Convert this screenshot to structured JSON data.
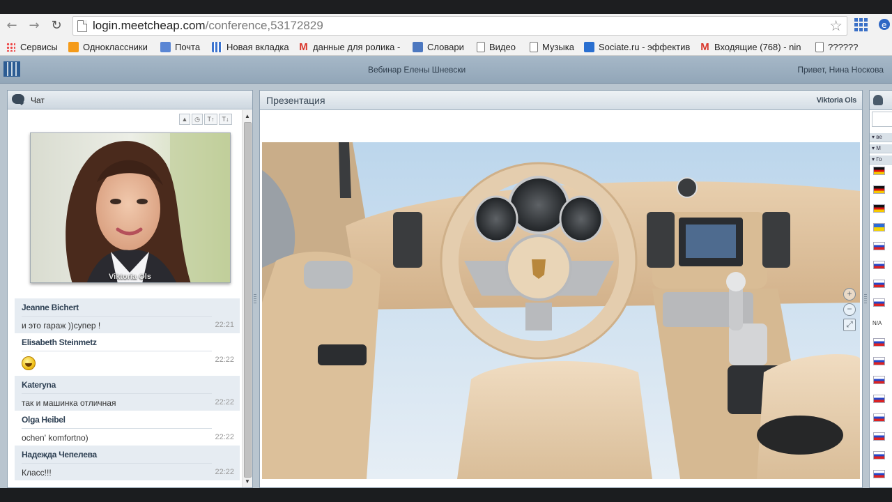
{
  "browser": {
    "url_host": "login.meetcheap.com",
    "url_path": "/conference,53172829",
    "back_icon": "back-arrow-icon",
    "forward_icon": "forward-arrow-icon",
    "reload_icon": "reload-icon",
    "bookmark_star_icon": "star-icon",
    "apps_icon": "apps-grid-icon"
  },
  "bookmarks": [
    {
      "label": "Сервисы",
      "icon": "apps-grid-icon"
    },
    {
      "label": "Одноклассники",
      "icon": "odnoklassniki-icon"
    },
    {
      "label": "Почта",
      "icon": "mail-icon"
    },
    {
      "label": "Новая вкладка",
      "icon": "tabs-icon"
    },
    {
      "label": "данные для ролика -",
      "icon": "gmail-icon"
    },
    {
      "label": "Словари",
      "icon": "dictionary-icon"
    },
    {
      "label": "Видео",
      "icon": "page-icon"
    },
    {
      "label": "Музыка",
      "icon": "page-icon"
    },
    {
      "label": "Sociate.ru - эффектив",
      "icon": "sociate-icon"
    },
    {
      "label": "Входящие (768) - nin",
      "icon": "gmail-icon"
    },
    {
      "label": "??????",
      "icon": "page-icon"
    }
  ],
  "app": {
    "title": "Вебинар Елены Шневски",
    "greeting": "Привет, Нина Носкова"
  },
  "chat": {
    "title": "Чат",
    "webcam_name": "Viktoria Ols",
    "messages": [
      {
        "author": "Jeanne Bichert",
        "text": "и это гараж ))супер !",
        "time": "22:21"
      },
      {
        "author": "Elisabeth Steinmetz",
        "text": "",
        "emoji": "smile-emoji-icon",
        "time": "22:22"
      },
      {
        "author": "Kateryna",
        "text": "так и машинка отличная",
        "time": "22:22"
      },
      {
        "author": "Olga Heibel",
        "text": "ochen' komfortno)",
        "time": "22:22"
      },
      {
        "author": "Надежда Чепелева",
        "text": "Класс!!!",
        "time": "22:22"
      }
    ]
  },
  "presentation": {
    "title": "Презентация",
    "presenter": "Viktoria Ols",
    "zoom_in_icon": "zoom-in-icon",
    "zoom_out_icon": "zoom-out-icon",
    "fit_icon": "fit-screen-icon"
  },
  "participants": {
    "groups": [
      "ве",
      "М",
      "Го"
    ],
    "na_label": "N/A"
  }
}
